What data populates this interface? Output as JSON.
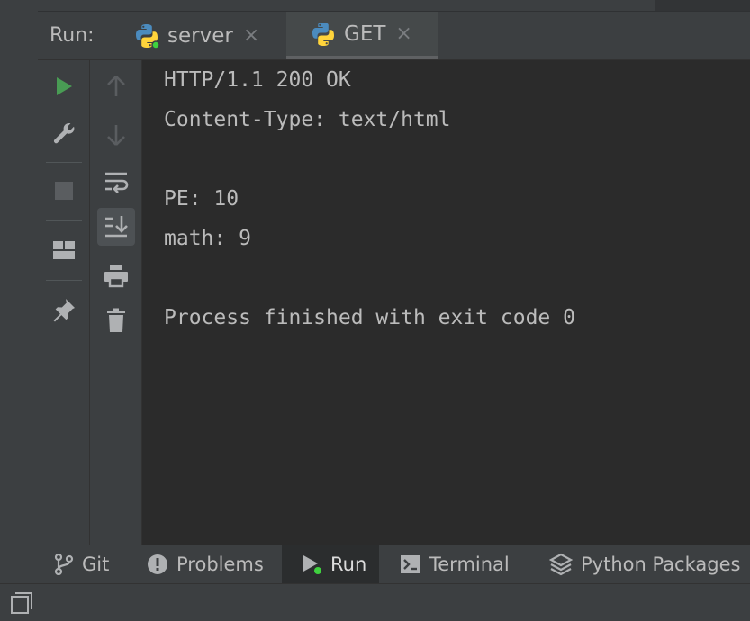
{
  "header": {
    "run_label": "Run:",
    "tabs": [
      {
        "label": "server",
        "icon": "python-icon",
        "active": false
      },
      {
        "label": "GET",
        "icon": "python-icon",
        "active": true
      }
    ],
    "close_glyph": "×"
  },
  "toolbar_left": {
    "items": [
      "rerun-icon",
      "wrench-icon",
      "stop-icon",
      "layout-icon",
      "pin-icon"
    ]
  },
  "toolbar_right": {
    "items": [
      "up-arrow-icon",
      "down-arrow-icon",
      "soft-wrap-icon",
      "scroll-to-end-icon",
      "print-icon",
      "trash-icon"
    ]
  },
  "console": {
    "lines": [
      "HTTP/1.1 200 OK",
      "Content-Type: text/html",
      "",
      "PE: 10",
      "math: 9",
      "",
      "Process finished with exit code 0"
    ]
  },
  "bottom_bar": {
    "items": [
      {
        "label": "Git",
        "icon": "git-branch-icon"
      },
      {
        "label": "Problems",
        "icon": "problems-icon"
      },
      {
        "label": "Run",
        "icon": "run-icon",
        "active": true
      },
      {
        "label": "Terminal",
        "icon": "terminal-icon"
      },
      {
        "label": "Python Packages",
        "icon": "layers-icon"
      }
    ]
  },
  "colors": {
    "background": "#2b2b2b",
    "panel": "#3c3f41",
    "text": "#bbbbbb",
    "run_green": "#499c54",
    "python_blue": "#4b8bbe",
    "python_yellow": "#ffd43b",
    "status_green": "#3fd13f"
  }
}
